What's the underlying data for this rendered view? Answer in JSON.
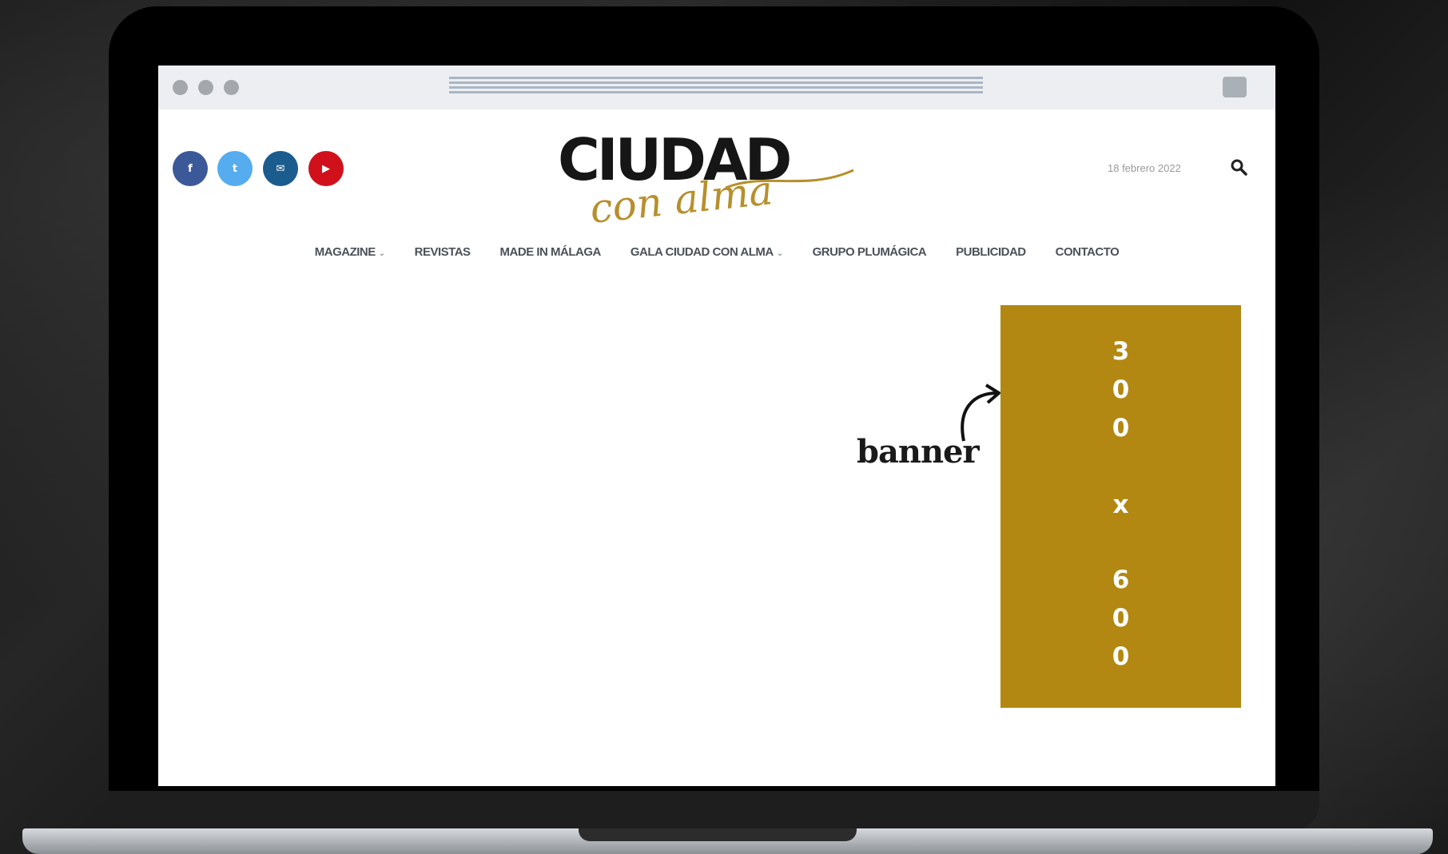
{
  "browser": {
    "window_dots": [
      "close",
      "minimize",
      "maximize"
    ]
  },
  "header": {
    "social": [
      {
        "name": "facebook",
        "glyph": "f",
        "color": "#3b5998"
      },
      {
        "name": "twitter",
        "glyph": "t",
        "color": "#55acee"
      },
      {
        "name": "email",
        "glyph": "✉",
        "color": "#1a5c8e"
      },
      {
        "name": "youtube",
        "glyph": "▶",
        "color": "#d0111b"
      }
    ],
    "logo": {
      "main": "CIUDAD",
      "sub": "con alma"
    },
    "date": "18 febrero 2022"
  },
  "nav": {
    "items": [
      {
        "label": "MAGAZINE",
        "dropdown": true
      },
      {
        "label": "REVISTAS",
        "dropdown": false
      },
      {
        "label": "MADE IN MÁLAGA",
        "dropdown": false
      },
      {
        "label": "GALA CIUDAD CON ALMA",
        "dropdown": true
      },
      {
        "label": "GRUPO PLUMÁGICA",
        "dropdown": false
      },
      {
        "label": "PUBLICIDAD",
        "dropdown": false
      },
      {
        "label": "CONTACTO",
        "dropdown": false
      }
    ]
  },
  "banner": {
    "label": "banner",
    "chars": [
      "3",
      "0",
      "0",
      "",
      "x",
      "",
      "6",
      "0",
      "0"
    ],
    "color": "#b28812"
  }
}
